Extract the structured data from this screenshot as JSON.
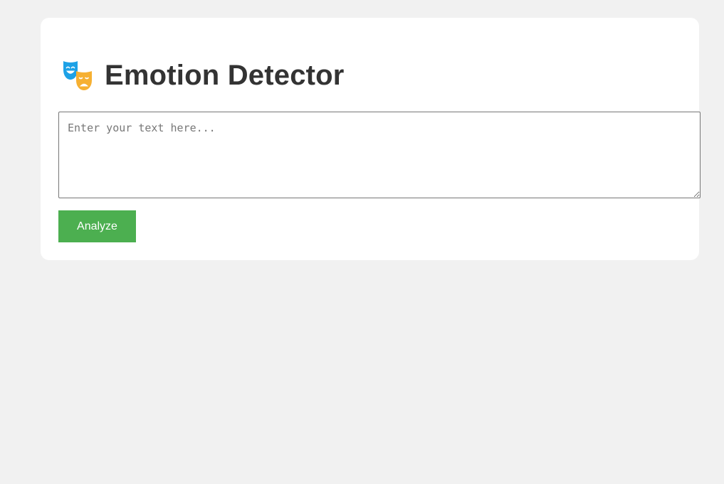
{
  "app": {
    "title": "Emotion Detector",
    "icon": "performing-arts-masks-icon"
  },
  "input": {
    "value": "",
    "placeholder": "Enter your text here..."
  },
  "actions": {
    "analyze_label": "Analyze"
  },
  "colors": {
    "page_background": "#f1f1f1",
    "card_background": "#ffffff",
    "title_text": "#333333",
    "button_background": "#4caf50",
    "button_text": "#ffffff",
    "comedy_mask": "#1da1e6",
    "tragedy_mask": "#f6b032"
  }
}
